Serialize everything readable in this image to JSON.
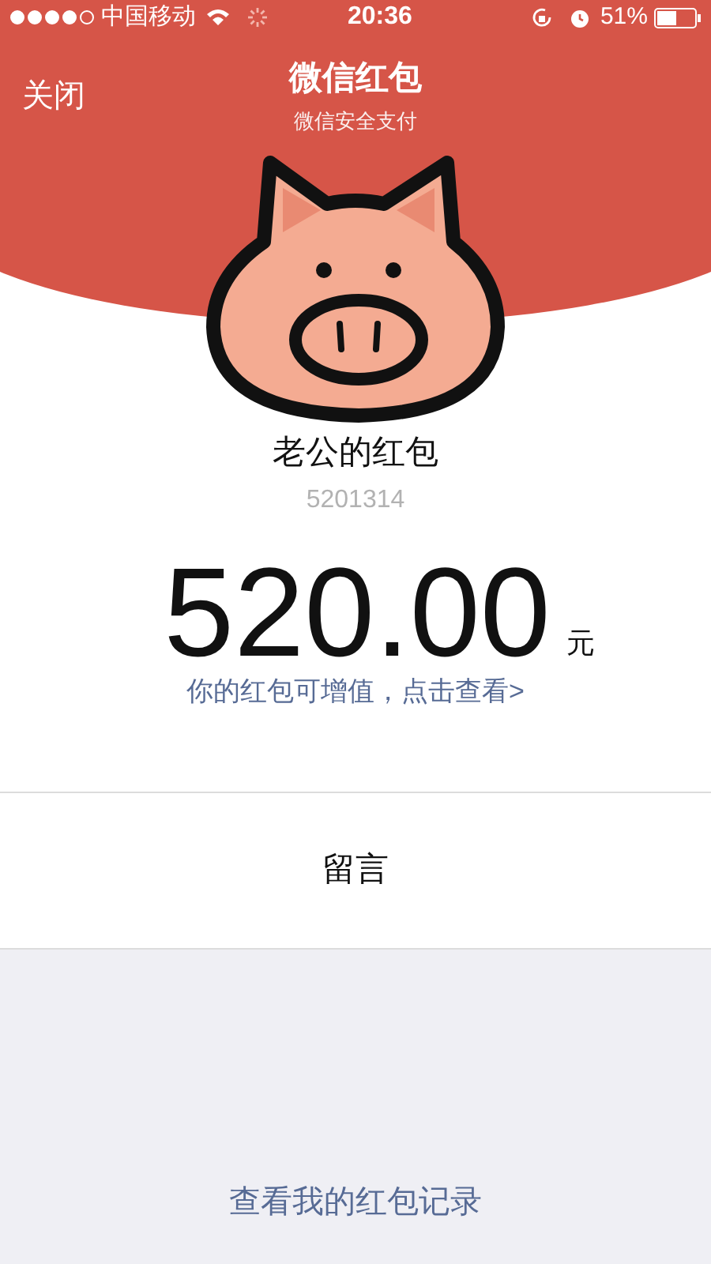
{
  "status_bar": {
    "carrier": "中国移动",
    "time": "20:36",
    "battery": "51%"
  },
  "nav": {
    "close": "关闭",
    "title": "微信红包",
    "subtitle": "微信安全支付"
  },
  "sender": {
    "name": "老公的红包",
    "note": "5201314"
  },
  "amount": {
    "value": "520.00",
    "unit": "元"
  },
  "upgrade_link": "你的红包可增值，点击查看>",
  "message_button": "留言",
  "records_link": "查看我的红包记录"
}
